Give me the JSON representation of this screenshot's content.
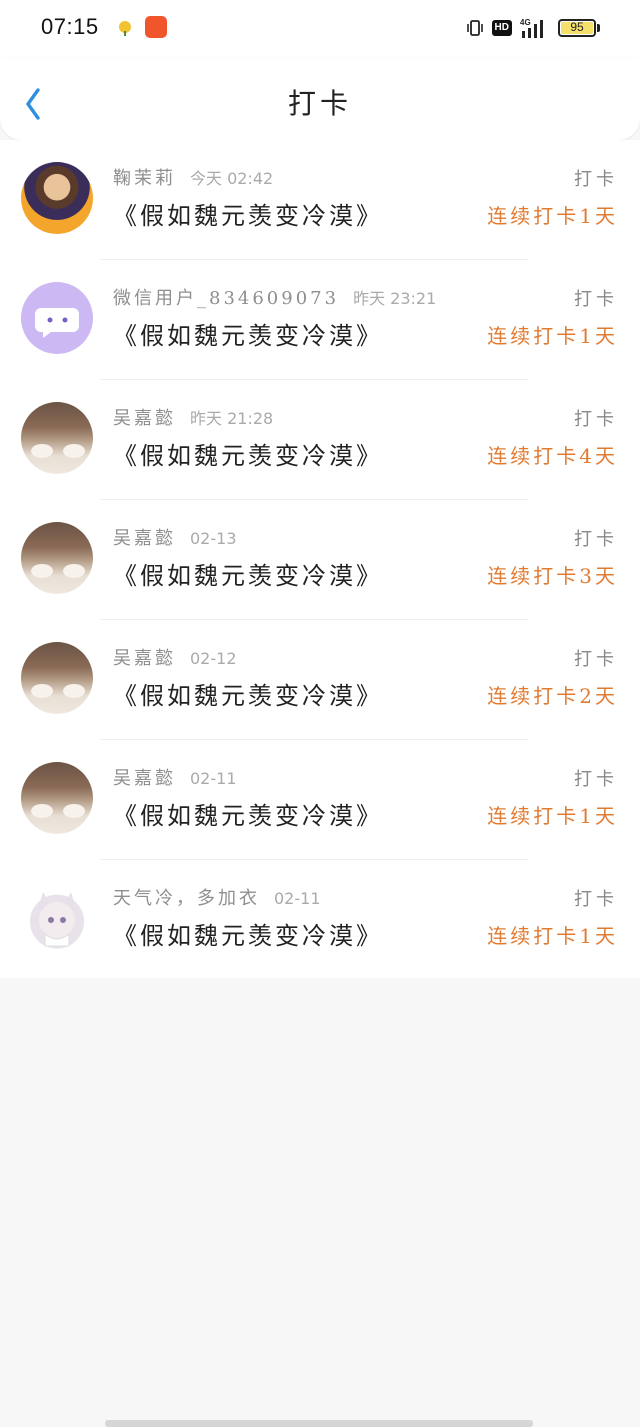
{
  "status_bar": {
    "time": "07:15",
    "battery": "95",
    "network": "4G"
  },
  "header": {
    "title": "打卡"
  },
  "items": [
    {
      "name": "鞠茉莉",
      "time": "今天 02:42",
      "title": "《假如魏元羡变冷漠》",
      "action": "打卡",
      "streak": "连续打卡1天"
    },
    {
      "name": "微信用户_834609073",
      "time": "昨天 23:21",
      "title": "《假如魏元羡变冷漠》",
      "action": "打卡",
      "streak": "连续打卡1天"
    },
    {
      "name": "吴嘉懿",
      "time": "昨天 21:28",
      "title": "《假如魏元羡变冷漠》",
      "action": "打卡",
      "streak": "连续打卡4天"
    },
    {
      "name": "吴嘉懿",
      "time": "02-13",
      "title": "《假如魏元羡变冷漠》",
      "action": "打卡",
      "streak": "连续打卡3天"
    },
    {
      "name": "吴嘉懿",
      "time": "02-12",
      "title": "《假如魏元羡变冷漠》",
      "action": "打卡",
      "streak": "连续打卡2天"
    },
    {
      "name": "吴嘉懿",
      "time": "02-11",
      "title": "《假如魏元羡变冷漠》",
      "action": "打卡",
      "streak": "连续打卡1天"
    },
    {
      "name": "天气冷，多加衣",
      "time": "02-11",
      "title": "《假如魏元羡变冷漠》",
      "action": "打卡",
      "streak": "连续打卡1天"
    }
  ],
  "colors": {
    "accent": "#e07b32",
    "back_arrow": "#2d8fe0"
  }
}
